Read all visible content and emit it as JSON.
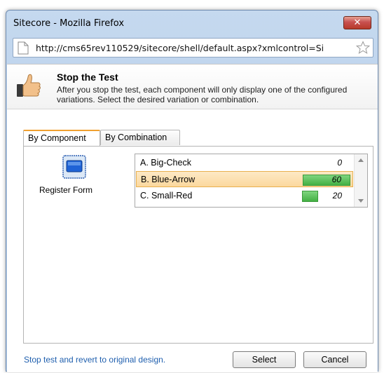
{
  "window": {
    "title": "Sitecore - Mozilla Firefox",
    "close_label": "✕"
  },
  "address_bar": {
    "url": "http://cms65rev110529/sitecore/shell/default.aspx?xmlcontrol=Si"
  },
  "dialog": {
    "title": "Stop the Test",
    "description": "After you stop the test, each component will only display one of the configured variations. Select the desired variation or combination."
  },
  "tabs": [
    {
      "label": "By Component",
      "active": true
    },
    {
      "label": "By Combination",
      "active": false
    }
  ],
  "component": {
    "label": "Register Form",
    "icon": "component-icon"
  },
  "variations": [
    {
      "label": "A. Big-Check",
      "value": "0",
      "percent": 0,
      "selected": false
    },
    {
      "label": "B. Blue-Arrow",
      "value": "60",
      "percent": 60,
      "selected": true
    },
    {
      "label": "C. Small-Red",
      "value": "20",
      "percent": 20,
      "selected": false
    }
  ],
  "footer": {
    "stop_link": "Stop test and revert to original design.",
    "select_label": "Select",
    "cancel_label": "Cancel"
  },
  "colors": {
    "accent_tab": "#f0a030",
    "bar_green": "#44b044",
    "link": "#1f5fae"
  }
}
